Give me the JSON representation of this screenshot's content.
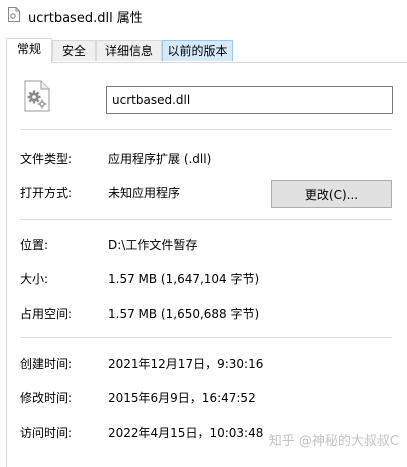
{
  "window": {
    "title": "ucrtbased.dll 属性"
  },
  "tabs": [
    {
      "label": "常规"
    },
    {
      "label": "安全"
    },
    {
      "label": "详细信息"
    },
    {
      "label": "以前的版本"
    }
  ],
  "general": {
    "file_name": "ucrtbased.dll",
    "file_type_label": "文件类型:",
    "file_type_value": "应用程序扩展 (.dll)",
    "opens_with_label": "打开方式:",
    "opens_with_value": "未知应用程序",
    "change_button": "更改(C)...",
    "location_label": "位置:",
    "location_value": "D:\\工作文件暂存",
    "size_label": "大小:",
    "size_value": "1.57 MB (1,647,104 字节)",
    "size_on_disk_label": "占用空间:",
    "size_on_disk_value": "1.57 MB (1,650,688 字节)",
    "created_label": "创建时间:",
    "created_value": "2021年12月17日，9:30:16",
    "modified_label": "修改时间:",
    "modified_value": "2015年6月9日，16:47:52",
    "accessed_label": "访问时间:",
    "accessed_value": "2022年4月15日，10:03:48"
  },
  "watermark": {
    "text": "知乎 @神秘的大叔叔C"
  },
  "icons": {
    "title_icon": "dll-file-icon",
    "file_icon": "dll-gear-file-icon"
  },
  "colors": {
    "selected_tab_hover": "#d8eaf9",
    "button_face": "#e1e1e1"
  }
}
